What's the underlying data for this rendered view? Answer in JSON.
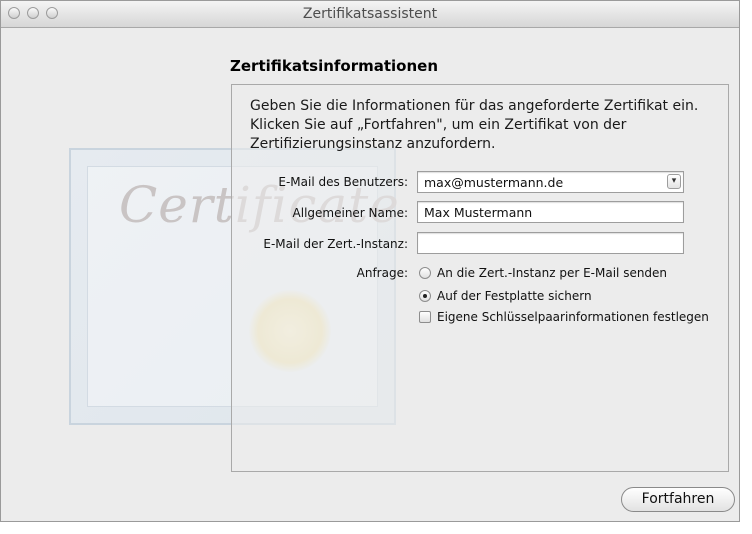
{
  "window": {
    "title": "Zertifikatsassistent"
  },
  "background": {
    "watermark_text": "Certificate"
  },
  "main": {
    "heading": "Zertifikatsinformationen",
    "intro": "Geben Sie die Informationen für das angeforderte Zertifikat ein. Klicken Sie auf „Fortfahren\", um ein Zertifikat von der Zertifizierungsinstanz anzufordern."
  },
  "form": {
    "email_label": "E-Mail des Benutzers:",
    "email_value": "max@mustermann.de",
    "name_label": "Allgemeiner Name:",
    "name_value": "Max Mustermann",
    "ca_email_label": "E-Mail der Zert.-Instanz:",
    "ca_email_value": "",
    "request_label": "Anfrage:",
    "option_send": "An die Zert.-Instanz per E-Mail senden",
    "option_save": "Auf der Festplatte sichern",
    "option_keypair": "Eigene Schlüsselpaarinformationen festlegen",
    "selected_option": "option_save",
    "keypair_checked": false
  },
  "footer": {
    "continue_label": "Fortfahren"
  }
}
